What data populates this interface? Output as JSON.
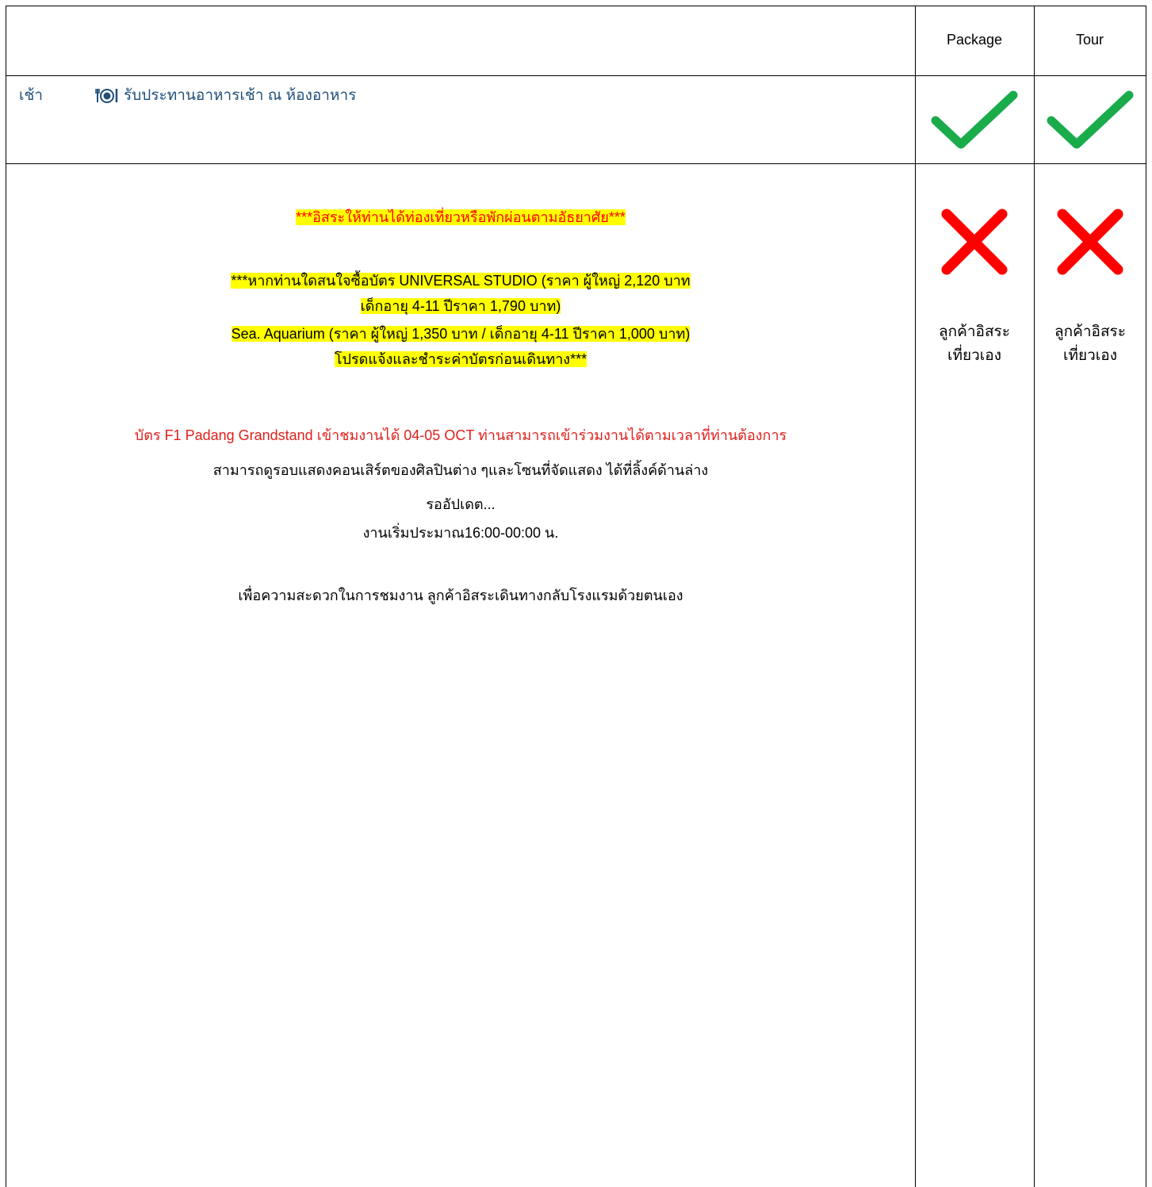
{
  "header": {
    "col_package": "Package",
    "col_tour": "Tour"
  },
  "breakfast": {
    "time": "เช้า",
    "icon": "plate-cutlery-icon",
    "text": "รับประทานอาหารเช้า ณ ห้องอาหาร",
    "package_status": "check-icon",
    "tour_status": "check-icon"
  },
  "free_day": {
    "headline": "***อิสระให้ท่านได้ท่องเที่ยวหรือพักผ่อนตามอัธยาศัย***",
    "ticket_line1": "***หากท่านใดสนใจซื้อบัตร UNIVERSAL STUDIO (ราคา ผู้ใหญ่ 2,120 บาท",
    "ticket_line2": "เด็กอายุ 4-11 ปีราคา 1,790 บาท)",
    "ticket_line3": "Sea. Aquarium (ราคา ผู้ใหญ่ 1,350 บาท / เด็กอายุ 4-11 ปีราคา 1,000 บาท)",
    "ticket_line4": "โปรดแจ้งและชำระค่าบัตรก่อนเดินทาง***",
    "f1_line": "บัตร F1 Padang Grandstand เข้าชมงานได้ 04-05 OCT ท่านสามารถเข้าร่วมงานได้ตามเวลาที่ท่านต้องการ",
    "concert_line": "สามารถดูรอบแสดงคอนเสิร์ตของศิลปินต่าง ๆและโซนที่จัดแสดง ได้ที่ลิ้งค์ด้านล่าง",
    "update_line": "รออัปเดต...",
    "time_line": "งานเริ่มประมาณ16:00-00:00 น.",
    "return_line": "เพื่อความสะดวกในการชมงาน ลูกค้าอิสระเดินทางกลับโรงแรมด้วยตนเอง",
    "package_status": "cross-icon",
    "tour_status": "cross-icon",
    "package_note_1": "ลูกค้าอิสระ",
    "package_note_2": "เที่ยวเอง",
    "tour_note_1": "ลูกค้าอิสระ",
    "tour_note_2": "เที่ยวเอง"
  },
  "colors": {
    "check": "#1aab4b",
    "cross": "#ff0000",
    "highlight": "#ffff00",
    "meal_text": "#1f4e79"
  }
}
